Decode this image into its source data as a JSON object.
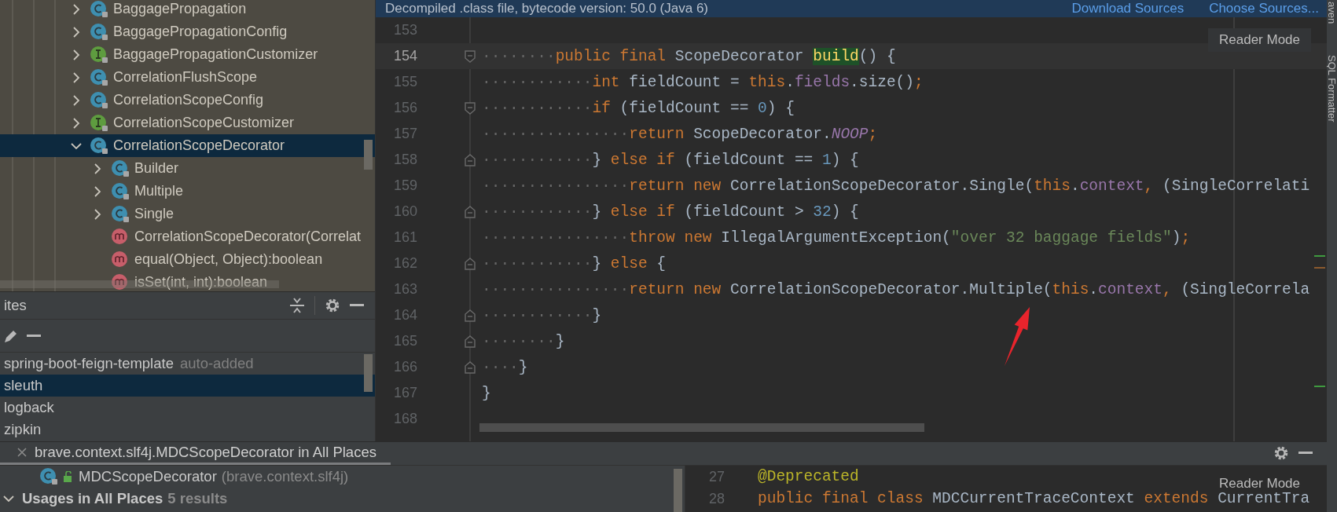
{
  "tree": {
    "items": [
      {
        "label": "BaggagePropagation",
        "kind": "class",
        "expanded": false,
        "selected": false
      },
      {
        "label": "BaggagePropagationConfig",
        "kind": "class",
        "expanded": false,
        "selected": false
      },
      {
        "label": "BaggagePropagationCustomizer",
        "kind": "interface",
        "expanded": false,
        "selected": false
      },
      {
        "label": "CorrelationFlushScope",
        "kind": "class",
        "expanded": false,
        "selected": false
      },
      {
        "label": "CorrelationScopeConfig",
        "kind": "class",
        "expanded": false,
        "selected": false
      },
      {
        "label": "CorrelationScopeCustomizer",
        "kind": "interface",
        "expanded": false,
        "selected": false
      },
      {
        "label": "CorrelationScopeDecorator",
        "kind": "class",
        "expanded": true,
        "selected": true,
        "children": [
          {
            "label": "Builder",
            "kind": "class",
            "expanded": false,
            "selected": false
          },
          {
            "label": "Multiple",
            "kind": "class",
            "expanded": false,
            "selected": false
          },
          {
            "label": "Single",
            "kind": "class",
            "expanded": false,
            "selected": false
          },
          {
            "label": "CorrelationScopeDecorator(Correlat",
            "kind": "method",
            "selected": false
          },
          {
            "label": "equal(Object, Object):boolean",
            "kind": "method",
            "selected": false
          },
          {
            "label": "isSet(int, int):boolean",
            "kind": "method",
            "selected": false
          }
        ]
      }
    ]
  },
  "favorites": {
    "title": "ites",
    "items": [
      {
        "label": "spring-boot-feign-template",
        "note": "auto-added",
        "selected": false
      },
      {
        "label": "sleuth",
        "selected": true
      },
      {
        "label": "logback",
        "selected": false
      },
      {
        "label": "zipkin",
        "selected": false
      }
    ]
  },
  "editor": {
    "banner": {
      "text": "Decompiled .class file, bytecode version: 50.0 (Java 6)",
      "links": [
        "Download Sources",
        "Choose Sources..."
      ]
    },
    "reader_mode": "Reader Mode",
    "lines": [
      {
        "number": "153",
        "current": false
      },
      {
        "number": "154",
        "indent": "········",
        "fold": {
          "kind": "start"
        },
        "current": true,
        "tokens": [
          {
            "kind": "keyword",
            "text": "public final "
          },
          {
            "kind": "plain",
            "text": "ScopeDecorator "
          },
          {
            "kind": "match",
            "text": "build"
          },
          {
            "kind": "plain",
            "text": "() {"
          }
        ]
      },
      {
        "number": "155",
        "indent": "············",
        "current": false,
        "tokens": [
          {
            "kind": "keyword",
            "text": "int "
          },
          {
            "kind": "plain",
            "text": "fieldCount = "
          },
          {
            "kind": "keyword",
            "text": "this"
          },
          {
            "kind": "plain",
            "text": "."
          },
          {
            "kind": "field",
            "text": "fields"
          },
          {
            "kind": "plain",
            "text": ".size()"
          },
          {
            "kind": "keyword",
            "text": ";"
          }
        ]
      },
      {
        "number": "156",
        "indent": "············",
        "fold": {
          "kind": "start"
        },
        "current": false,
        "tokens": [
          {
            "kind": "keyword",
            "text": "if "
          },
          {
            "kind": "plain",
            "text": "(fieldCount == "
          },
          {
            "kind": "number",
            "text": "0"
          },
          {
            "kind": "plain",
            "text": ") {"
          }
        ]
      },
      {
        "number": "157",
        "indent": "················",
        "current": false,
        "tokens": [
          {
            "kind": "keyword",
            "text": "return "
          },
          {
            "kind": "plain",
            "text": "ScopeDecorator."
          },
          {
            "kind": "static",
            "text": "NOOP"
          },
          {
            "kind": "keyword",
            "text": ";"
          }
        ]
      },
      {
        "number": "158",
        "indent": "············",
        "fold": {
          "kind": "end"
        },
        "current": false,
        "tokens": [
          {
            "kind": "plain",
            "text": "} "
          },
          {
            "kind": "keyword",
            "text": "else if "
          },
          {
            "kind": "plain",
            "text": "(fieldCount == "
          },
          {
            "kind": "number",
            "text": "1"
          },
          {
            "kind": "plain",
            "text": ") {"
          }
        ]
      },
      {
        "number": "159",
        "indent": "················",
        "current": false,
        "tokens": [
          {
            "kind": "keyword",
            "text": "return new "
          },
          {
            "kind": "plain",
            "text": "CorrelationScopeDecorator.Single("
          },
          {
            "kind": "keyword",
            "text": "this"
          },
          {
            "kind": "plain",
            "text": "."
          },
          {
            "kind": "field",
            "text": "context"
          },
          {
            "kind": "keyword",
            "text": ", "
          },
          {
            "kind": "plain",
            "text": "(SingleCorrelati"
          }
        ]
      },
      {
        "number": "160",
        "indent": "············",
        "fold": {
          "kind": "end"
        },
        "current": false,
        "tokens": [
          {
            "kind": "plain",
            "text": "} "
          },
          {
            "kind": "keyword",
            "text": "else if "
          },
          {
            "kind": "plain",
            "text": "(fieldCount > "
          },
          {
            "kind": "number",
            "text": "32"
          },
          {
            "kind": "plain",
            "text": ") {"
          }
        ]
      },
      {
        "number": "161",
        "indent": "················",
        "current": false,
        "tokens": [
          {
            "kind": "keyword",
            "text": "throw new "
          },
          {
            "kind": "plain",
            "text": "IllegalArgumentException("
          },
          {
            "kind": "string",
            "text": "\"over 32 baggage fields\""
          },
          {
            "kind": "plain",
            "text": ")"
          },
          {
            "kind": "keyword",
            "text": ";"
          }
        ]
      },
      {
        "number": "162",
        "indent": "············",
        "fold": {
          "kind": "end"
        },
        "current": false,
        "tokens": [
          {
            "kind": "plain",
            "text": "} "
          },
          {
            "kind": "keyword",
            "text": "else "
          },
          {
            "kind": "plain",
            "text": "{"
          }
        ]
      },
      {
        "number": "163",
        "indent": "················",
        "current": false,
        "tokens": [
          {
            "kind": "keyword",
            "text": "return new "
          },
          {
            "kind": "plain",
            "text": "CorrelationScopeDecorator.Multiple("
          },
          {
            "kind": "keyword",
            "text": "this"
          },
          {
            "kind": "plain",
            "text": "."
          },
          {
            "kind": "field",
            "text": "context"
          },
          {
            "kind": "keyword",
            "text": ", "
          },
          {
            "kind": "plain",
            "text": "(SingleCorrela"
          }
        ]
      },
      {
        "number": "164",
        "indent": "············",
        "fold": {
          "kind": "end"
        },
        "current": false,
        "tokens": [
          {
            "kind": "plain",
            "text": "}"
          }
        ]
      },
      {
        "number": "165",
        "indent": "········",
        "fold": {
          "kind": "end"
        },
        "current": false,
        "tokens": [
          {
            "kind": "plain",
            "text": "}"
          }
        ]
      },
      {
        "number": "166",
        "indent": "····",
        "fold": {
          "kind": "end"
        },
        "current": false,
        "tokens": [
          {
            "kind": "plain",
            "text": "}"
          }
        ]
      },
      {
        "number": "167",
        "current": false,
        "tokens": [
          {
            "kind": "plain",
            "text": "}"
          }
        ]
      },
      {
        "number": "168",
        "current": false
      }
    ]
  },
  "side_strip": [
    "aven",
    "SQL Formatter"
  ],
  "find_panel": {
    "tab": "brave.context.slf4j.MDCScopeDecorator in All Places",
    "target": {
      "name": "MDCScopeDecorator",
      "package": "(brave.context.slf4j)"
    },
    "group": {
      "label": "Usages in All Places",
      "count": "5 results",
      "expanded": true
    },
    "preview": {
      "reader_mode": "Reader Mode",
      "lines": [
        {
          "number": "27",
          "tokens": [
            {
              "kind": "annotation",
              "text": "@Deprecated"
            }
          ]
        },
        {
          "number": "28",
          "tokens": [
            {
              "kind": "keyword",
              "text": "public final class "
            },
            {
              "kind": "plain",
              "text": "MDCCurrentTraceContext "
            },
            {
              "kind": "keyword",
              "text": "extends "
            },
            {
              "kind": "plain",
              "text": "CurrentTra"
            }
          ]
        }
      ]
    }
  }
}
